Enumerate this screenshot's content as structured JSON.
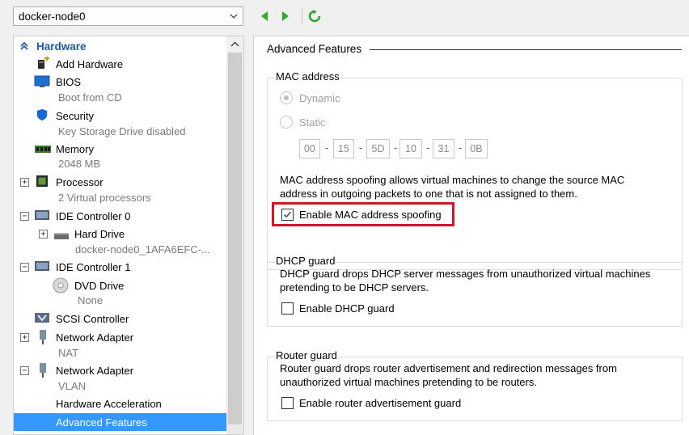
{
  "toolbar": {
    "vm_name": "docker-node0",
    "back_icon": "green-left-arrow",
    "forward_icon": "green-right-arrow",
    "refresh_icon": "green-refresh"
  },
  "tree": {
    "section_title": "Hardware",
    "items": [
      {
        "label": "Add Hardware"
      },
      {
        "label": "BIOS",
        "sub": "Boot from CD"
      },
      {
        "label": "Security",
        "sub": "Key Storage Drive disabled"
      },
      {
        "label": "Memory",
        "sub": "2048 MB"
      },
      {
        "label": "Processor",
        "sub": "2 Virtual processors"
      },
      {
        "label": "IDE Controller 0"
      },
      {
        "label": "Hard Drive",
        "sub": "docker-node0_1AFA6EFC-..."
      },
      {
        "label": "IDE Controller 1"
      },
      {
        "label": "DVD Drive",
        "sub": "None"
      },
      {
        "label": "SCSI Controller"
      },
      {
        "label": "Network Adapter",
        "sub": "NAT"
      },
      {
        "label": "Network Adapter",
        "sub": "VLAN"
      },
      {
        "label": "Hardware Acceleration"
      },
      {
        "label": "Advanced Features"
      }
    ]
  },
  "panel": {
    "title": "Advanced Features",
    "mac": {
      "group_title": "MAC address",
      "dynamic_label": "Dynamic",
      "static_label": "Static",
      "octets": [
        "00",
        "15",
        "5D",
        "10",
        "31",
        "0B"
      ],
      "spoofing_description_1": "MAC address spoofing allows virtual machines to change the source MAC",
      "spoofing_description_2": "address in outgoing packets to one that is not assigned to them.",
      "spoofing_label": "Enable MAC address spoofing",
      "spoofing_checked": true
    },
    "dhcp": {
      "group_title": "DHCP guard",
      "description_1": "DHCP guard drops DHCP server messages from unauthorized virtual machines",
      "description_2": "pretending to be DHCP servers.",
      "label": "Enable DHCP guard",
      "checked": false
    },
    "router": {
      "group_title": "Router guard",
      "description_1": "Router guard drops router advertisement and redirection messages from",
      "description_2": "unauthorized virtual machines pretending to be routers.",
      "label": "Enable router advertisement guard",
      "checked": false
    }
  },
  "colors": {
    "selection": "#3399ff",
    "section_header": "#1e5aa8",
    "highlight_box": "#d0152b",
    "toolbar_green": "#2eaa2e"
  }
}
